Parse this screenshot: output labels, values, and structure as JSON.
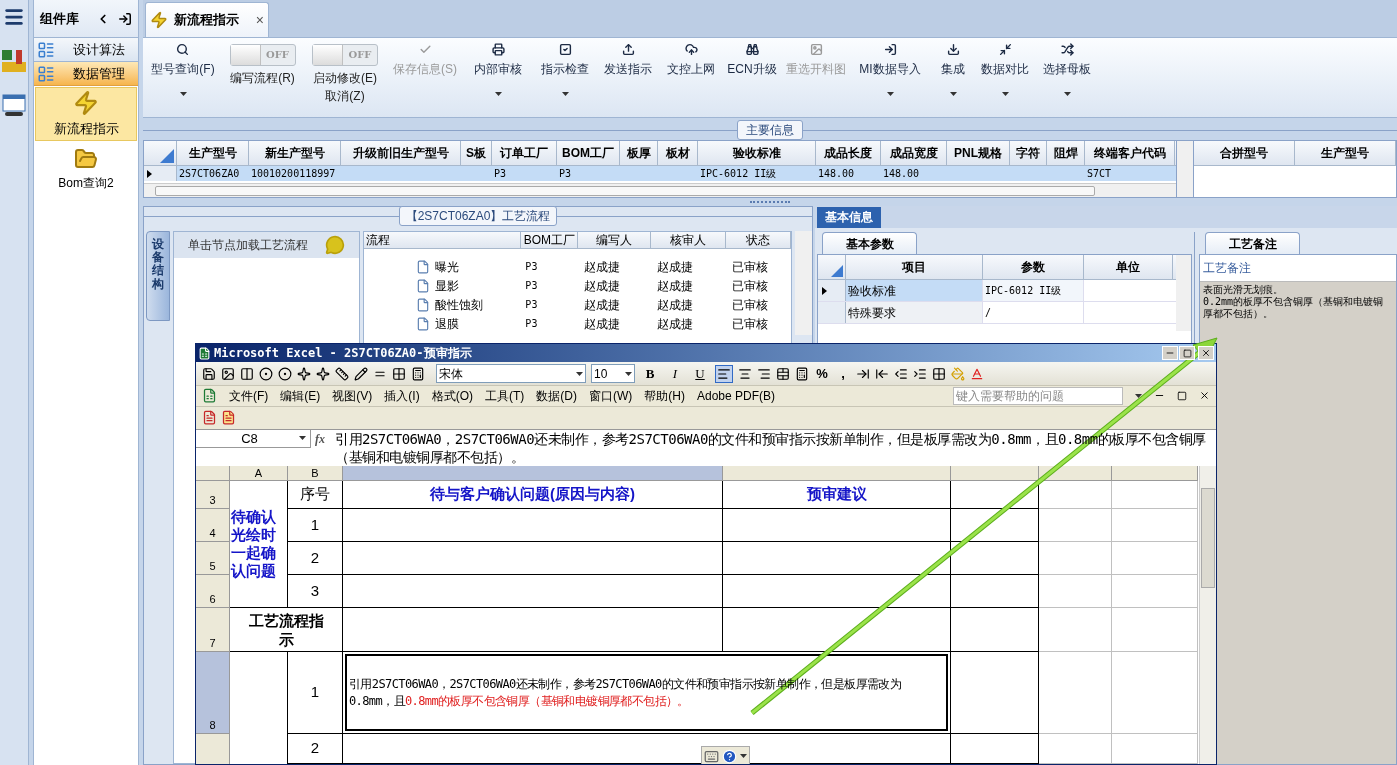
{
  "sidebar": {
    "title": "组件库",
    "nav_items": [
      {
        "label": "设计算法",
        "selected": false
      },
      {
        "label": "数据管理",
        "selected": true
      }
    ],
    "tiles": [
      {
        "kind": "bolt",
        "label": "新流程指示",
        "selected": true
      },
      {
        "kind": "folder",
        "label": "Bom查询2",
        "selected": false
      }
    ]
  },
  "tabs": [
    {
      "label": "新流程指示",
      "selected": true,
      "close": "×"
    }
  ],
  "toolbar": [
    {
      "kind": "button",
      "label": "型号查询(F)",
      "disabled": false,
      "dropdown": true
    },
    {
      "kind": "toggle",
      "state_text": "OFF",
      "on": false,
      "label": "编写流程(R)"
    },
    {
      "kind": "toggle",
      "state_text": "OFF",
      "on": false,
      "label": "启动修改(E)",
      "sublabel": "取消(Z)"
    },
    {
      "kind": "button",
      "label": "保存信息(S)",
      "disabled": true,
      "dropdown": false
    },
    {
      "kind": "button",
      "label": "内部审核",
      "disabled": false,
      "dropdown": true
    },
    {
      "kind": "button",
      "label": "指示检查",
      "disabled": false,
      "dropdown": true
    },
    {
      "kind": "button",
      "label": "发送指示",
      "disabled": false,
      "dropdown": false
    },
    {
      "kind": "button",
      "label": "文控上网",
      "disabled": false,
      "dropdown": false
    },
    {
      "kind": "button",
      "label": "ECN升级",
      "disabled": false,
      "dropdown": false
    },
    {
      "kind": "button",
      "label": "重选开料图",
      "disabled": true,
      "dropdown": false
    },
    {
      "kind": "button",
      "label": "MI数据导入",
      "disabled": false,
      "dropdown": true
    },
    {
      "kind": "button",
      "label": "集成",
      "disabled": false,
      "dropdown": true
    },
    {
      "kind": "button",
      "label": "数据对比",
      "disabled": false,
      "dropdown": true
    },
    {
      "kind": "button",
      "label": "选择母板",
      "disabled": false,
      "dropdown": true
    }
  ],
  "main_info": {
    "title": "主要信息",
    "columns": [
      "生产型号",
      "新生产型号",
      "升级前旧生产型号",
      "S板",
      "订单工厂",
      "BOM工厂",
      "板厚",
      "板材",
      "验收标准",
      "成品长度",
      "成品宽度",
      "PNL规格",
      "字符",
      "阻焊",
      "终端客户代码"
    ],
    "rows": [
      {
        "selected": true,
        "cells": [
          "2S7CT06ZA0",
          "10010200118997",
          null,
          null,
          "P3",
          "P3",
          null,
          null,
          "IPC-6012 II级",
          "148.00",
          "148.00",
          null,
          null,
          null,
          "S7CT"
        ]
      }
    ],
    "side_columns": [
      "合拼型号",
      "生产型号"
    ]
  },
  "process_panel": {
    "title": "【2S7CT06ZA0】工艺流程",
    "side_tab": "设备结构",
    "hint": "单击节点加载工艺流程",
    "columns": [
      "流程",
      "BOM工厂",
      "编写人",
      "核审人",
      "状态"
    ],
    "rows": [
      {
        "cells": [
          "曝光",
          "P3",
          "赵成捷",
          "赵成捷",
          "已审核"
        ]
      },
      {
        "cells": [
          "显影",
          "P3",
          "赵成捷",
          "赵成捷",
          "已审核"
        ]
      },
      {
        "cells": [
          "酸性蚀刻",
          "P3",
          "赵成捷",
          "赵成捷",
          "已审核"
        ]
      },
      {
        "cells": [
          "退膜",
          "P3",
          "赵成捷",
          "赵成捷",
          "已审核"
        ]
      }
    ]
  },
  "basic_info": {
    "tab": "基本信息",
    "subtab": "基本参数",
    "columns": [
      "项目",
      "参数",
      "单位"
    ],
    "rows": [
      {
        "selected": true,
        "item": "验收标准",
        "value": "IPC-6012 II级"
      },
      {
        "selected": false,
        "item": "特殊要求",
        "value": "/"
      }
    ]
  },
  "remarks": {
    "tab": "工艺备注",
    "label": "工艺备注",
    "lines": [
      "表面光滑无划痕。",
      "0.2mm的板厚不包含铜厚（基铜和电镀铜厚都不包括）。"
    ]
  },
  "excel": {
    "title": "Microsoft Excel - 2S7CT06ZA0-预审指示",
    "font": "宋体",
    "font_size": "10",
    "format_buttons": [
      "B",
      "I",
      "U"
    ],
    "symbols": [
      "%",
      ","
    ],
    "menu": [
      "文件(F)",
      "编辑(E)",
      "视图(V)",
      "插入(I)",
      "格式(O)",
      "工具(T)",
      "数据(D)",
      "窗口(W)",
      "帮助(H)",
      "Adobe PDF(B)"
    ],
    "help_placeholder": "键入需要帮助的问题",
    "name_box": "C8",
    "function_label": "fx",
    "formula": "引用2S7CT06WA0，2S7CT06WA0还未制作，参考2S7CT06WA0的文件和预审指示按新单制作，但是板厚需改为0.8mm，且0.8mm的板厚不包含铜厚（基铜和电镀铜厚都不包括）。",
    "column_letters": [
      "A",
      "B"
    ],
    "row_numbers": [
      "3",
      "4",
      "5",
      "6",
      "7",
      "8"
    ],
    "group_label": "待确认光绘时一起确认问题",
    "header_no": "序号",
    "header_issue": "待与客户确认问题(原因与内容)",
    "header_advice": "预审建议",
    "issue_numbers": [
      "1",
      "2",
      "3"
    ],
    "process_label": "工艺流程指示",
    "process_numbers": [
      "1",
      "2"
    ],
    "process_text": [
      {
        "text": "引用2S7CT06WA0，2S7CT06WA0还未制作，参考2S7CT06WA0的文件和预审指示按新单制作，但是板厚需改为0.8mm，且",
        "color": "#000000"
      },
      {
        "text": "0.8mm的板厚不包含铜厚（基铜和电镀铜厚都不包括）。",
        "color": "#e02020"
      }
    ]
  }
}
